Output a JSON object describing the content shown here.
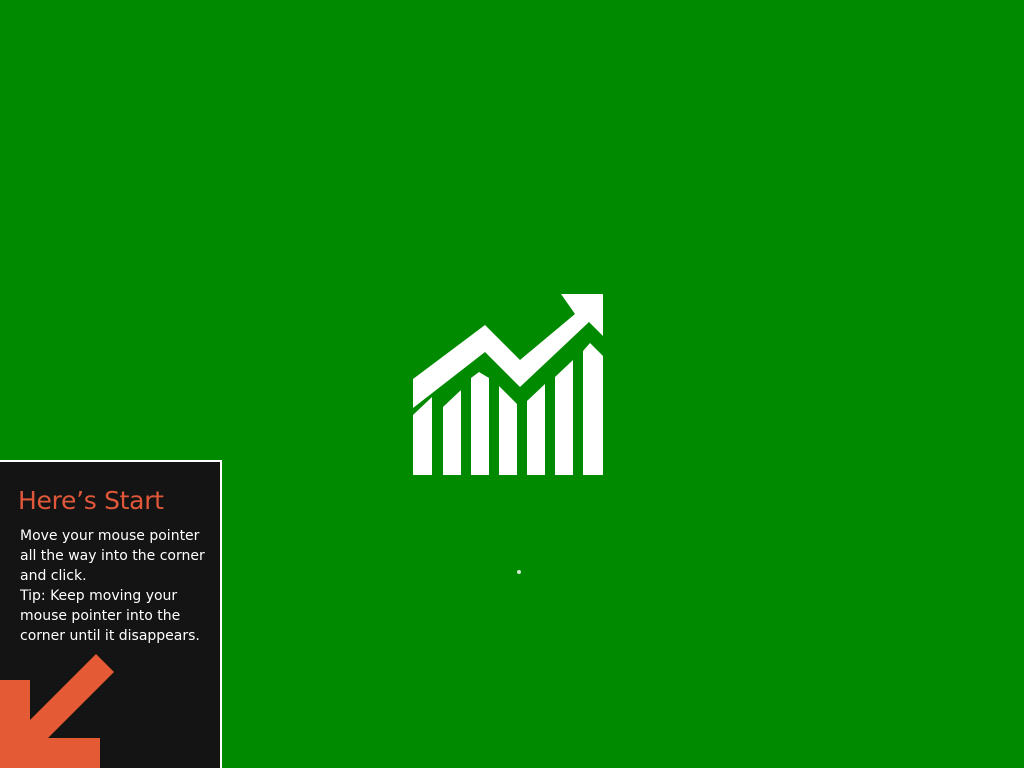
{
  "colors": {
    "background": "#008a00",
    "logo": "#ffffff",
    "tip_background": "#141414",
    "tip_title": "#e0573a",
    "tip_text": "#ffffff",
    "arrow": "#e35a35",
    "loading_dot": "#cfe8cf"
  },
  "splash": {
    "logo_icon": "finance-chart-icon",
    "loading_icon": "loading-dot"
  },
  "start_tip": {
    "title": "Here’s Start",
    "lines": [
      "Move your mouse pointer",
      "all the way into the corner",
      "and click.",
      "Tip: Keep moving your",
      "mouse pointer into the",
      "corner until it disappears."
    ],
    "arrow_icon": "down-left-arrow-icon"
  }
}
